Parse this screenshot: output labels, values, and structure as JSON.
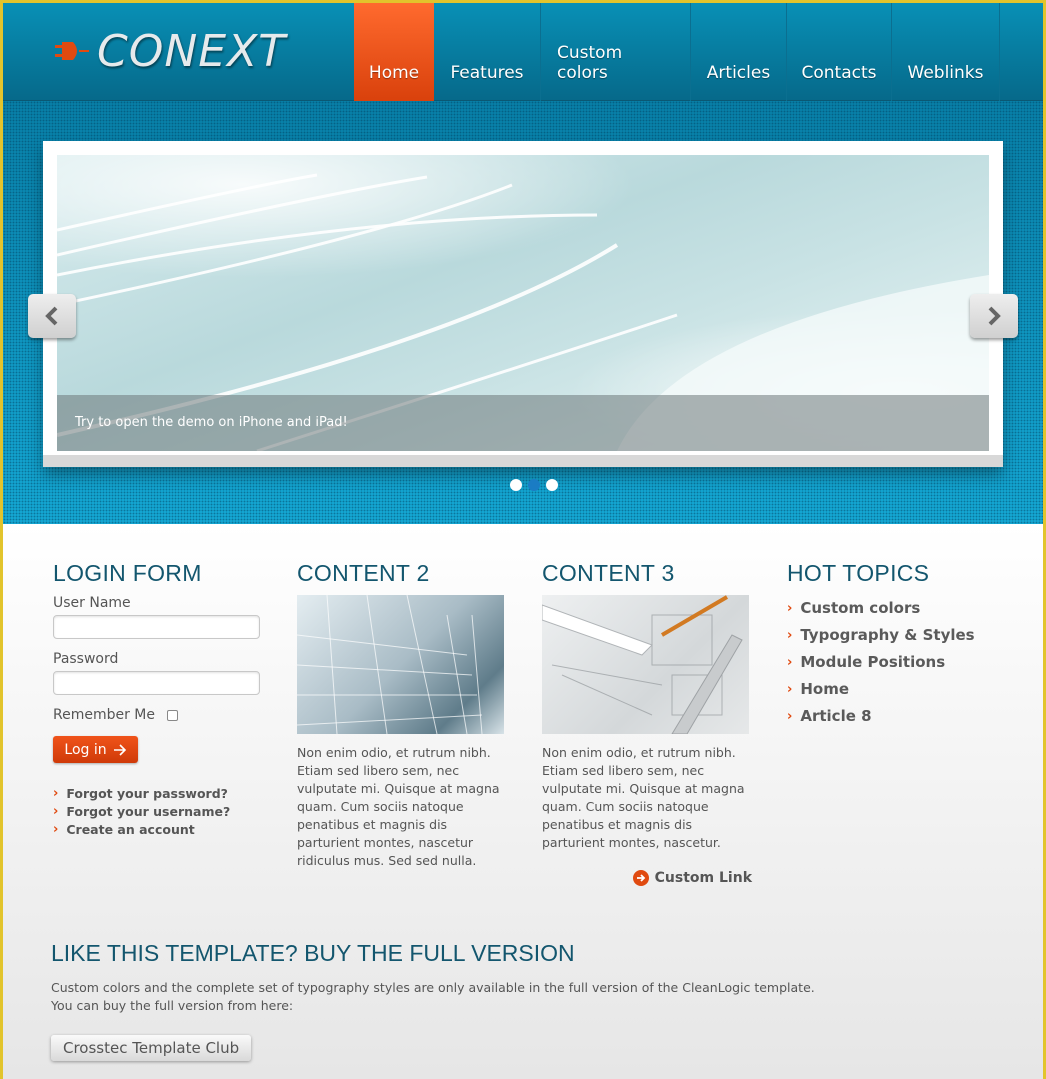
{
  "brand": {
    "name": "CONEXT",
    "icon": "plug-icon",
    "accent": "#e04a10",
    "header_blue": "#0787ad",
    "heading_color": "#13566e"
  },
  "nav": {
    "items": [
      {
        "label": "Home",
        "active": true
      },
      {
        "label": "Features",
        "active": false
      },
      {
        "label": "Custom colors",
        "active": false
      },
      {
        "label": "Articles",
        "active": false
      },
      {
        "label": "Contacts",
        "active": false
      },
      {
        "label": "Weblinks",
        "active": false
      }
    ]
  },
  "slider": {
    "caption": "Try to open the demo on iPhone and iPad!",
    "prev_icon": "chevron-left-icon",
    "next_icon": "chevron-right-icon",
    "slides_count": 3,
    "active_slide": 2
  },
  "login": {
    "title": "LOGIN FORM",
    "username_label": "User Name",
    "username_value": "",
    "password_label": "Password",
    "password_value": "",
    "remember_label": "Remember Me",
    "remember_checked": false,
    "submit_label": "Log in",
    "links": [
      "Forgot your password?",
      "Forgot your username?",
      "Create an account"
    ]
  },
  "content2": {
    "title": "CONTENT 2",
    "text": "Non enim odio, et rutrum nibh. Etiam sed libero sem, nec vulputate mi. Quisque at magna quam. Cum sociis natoque penatibus et magnis dis parturient montes, nascetur ridiculus mus. Sed sed nulla."
  },
  "content3": {
    "title": "CONTENT 3",
    "text": "Non enim odio, et rutrum nibh. Etiam sed libero sem, nec vulputate mi. Quisque at magna quam. Cum sociis natoque penatibus et magnis dis parturient montes, nascetur.",
    "link_label": "Custom Link"
  },
  "hot_topics": {
    "title": "HOT TOPICS",
    "items": [
      "Custom colors",
      "Typography & Styles",
      "Module Positions",
      "Home",
      "Article 8"
    ]
  },
  "promo": {
    "title": "LIKE THIS TEMPLATE? BUY THE FULL VERSION",
    "line1": "Custom colors and the complete set of typography styles are only available in the full version of the CleanLogic template.",
    "line2": "You can buy the full version from here:",
    "button_label": "Crosstec Template Club"
  }
}
